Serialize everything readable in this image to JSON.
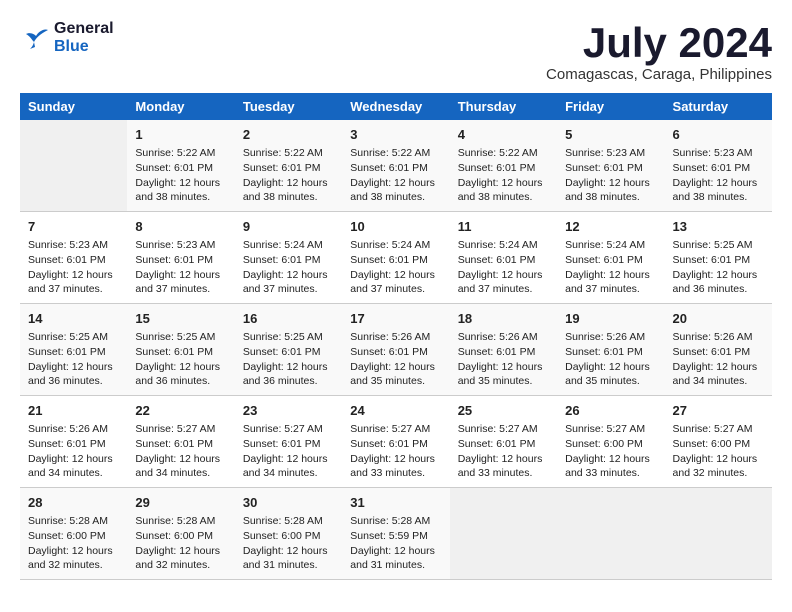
{
  "header": {
    "logo_line1": "General",
    "logo_line2": "Blue",
    "title": "July 2024",
    "subtitle": "Comagascas, Caraga, Philippines"
  },
  "calendar": {
    "days_of_week": [
      "Sunday",
      "Monday",
      "Tuesday",
      "Wednesday",
      "Thursday",
      "Friday",
      "Saturday"
    ],
    "weeks": [
      [
        {
          "day": "",
          "empty": true
        },
        {
          "day": "1",
          "sunrise": "5:22 AM",
          "sunset": "6:01 PM",
          "daylight": "12 hours and 38 minutes."
        },
        {
          "day": "2",
          "sunrise": "5:22 AM",
          "sunset": "6:01 PM",
          "daylight": "12 hours and 38 minutes."
        },
        {
          "day": "3",
          "sunrise": "5:22 AM",
          "sunset": "6:01 PM",
          "daylight": "12 hours and 38 minutes."
        },
        {
          "day": "4",
          "sunrise": "5:22 AM",
          "sunset": "6:01 PM",
          "daylight": "12 hours and 38 minutes."
        },
        {
          "day": "5",
          "sunrise": "5:23 AM",
          "sunset": "6:01 PM",
          "daylight": "12 hours and 38 minutes."
        },
        {
          "day": "6",
          "sunrise": "5:23 AM",
          "sunset": "6:01 PM",
          "daylight": "12 hours and 38 minutes."
        }
      ],
      [
        {
          "day": "7",
          "sunrise": "5:23 AM",
          "sunset": "6:01 PM",
          "daylight": "12 hours and 37 minutes."
        },
        {
          "day": "8",
          "sunrise": "5:23 AM",
          "sunset": "6:01 PM",
          "daylight": "12 hours and 37 minutes."
        },
        {
          "day": "9",
          "sunrise": "5:24 AM",
          "sunset": "6:01 PM",
          "daylight": "12 hours and 37 minutes."
        },
        {
          "day": "10",
          "sunrise": "5:24 AM",
          "sunset": "6:01 PM",
          "daylight": "12 hours and 37 minutes."
        },
        {
          "day": "11",
          "sunrise": "5:24 AM",
          "sunset": "6:01 PM",
          "daylight": "12 hours and 37 minutes."
        },
        {
          "day": "12",
          "sunrise": "5:24 AM",
          "sunset": "6:01 PM",
          "daylight": "12 hours and 37 minutes."
        },
        {
          "day": "13",
          "sunrise": "5:25 AM",
          "sunset": "6:01 PM",
          "daylight": "12 hours and 36 minutes."
        }
      ],
      [
        {
          "day": "14",
          "sunrise": "5:25 AM",
          "sunset": "6:01 PM",
          "daylight": "12 hours and 36 minutes."
        },
        {
          "day": "15",
          "sunrise": "5:25 AM",
          "sunset": "6:01 PM",
          "daylight": "12 hours and 36 minutes."
        },
        {
          "day": "16",
          "sunrise": "5:25 AM",
          "sunset": "6:01 PM",
          "daylight": "12 hours and 36 minutes."
        },
        {
          "day": "17",
          "sunrise": "5:26 AM",
          "sunset": "6:01 PM",
          "daylight": "12 hours and 35 minutes."
        },
        {
          "day": "18",
          "sunrise": "5:26 AM",
          "sunset": "6:01 PM",
          "daylight": "12 hours and 35 minutes."
        },
        {
          "day": "19",
          "sunrise": "5:26 AM",
          "sunset": "6:01 PM",
          "daylight": "12 hours and 35 minutes."
        },
        {
          "day": "20",
          "sunrise": "5:26 AM",
          "sunset": "6:01 PM",
          "daylight": "12 hours and 34 minutes."
        }
      ],
      [
        {
          "day": "21",
          "sunrise": "5:26 AM",
          "sunset": "6:01 PM",
          "daylight": "12 hours and 34 minutes."
        },
        {
          "day": "22",
          "sunrise": "5:27 AM",
          "sunset": "6:01 PM",
          "daylight": "12 hours and 34 minutes."
        },
        {
          "day": "23",
          "sunrise": "5:27 AM",
          "sunset": "6:01 PM",
          "daylight": "12 hours and 34 minutes."
        },
        {
          "day": "24",
          "sunrise": "5:27 AM",
          "sunset": "6:01 PM",
          "daylight": "12 hours and 33 minutes."
        },
        {
          "day": "25",
          "sunrise": "5:27 AM",
          "sunset": "6:01 PM",
          "daylight": "12 hours and 33 minutes."
        },
        {
          "day": "26",
          "sunrise": "5:27 AM",
          "sunset": "6:00 PM",
          "daylight": "12 hours and 33 minutes."
        },
        {
          "day": "27",
          "sunrise": "5:27 AM",
          "sunset": "6:00 PM",
          "daylight": "12 hours and 32 minutes."
        }
      ],
      [
        {
          "day": "28",
          "sunrise": "5:28 AM",
          "sunset": "6:00 PM",
          "daylight": "12 hours and 32 minutes."
        },
        {
          "day": "29",
          "sunrise": "5:28 AM",
          "sunset": "6:00 PM",
          "daylight": "12 hours and 32 minutes."
        },
        {
          "day": "30",
          "sunrise": "5:28 AM",
          "sunset": "6:00 PM",
          "daylight": "12 hours and 31 minutes."
        },
        {
          "day": "31",
          "sunrise": "5:28 AM",
          "sunset": "5:59 PM",
          "daylight": "12 hours and 31 minutes."
        },
        {
          "day": "",
          "empty": true
        },
        {
          "day": "",
          "empty": true
        },
        {
          "day": "",
          "empty": true
        }
      ]
    ]
  },
  "labels": {
    "sunrise_prefix": "Sunrise: ",
    "sunset_prefix": "Sunset: ",
    "daylight_prefix": "Daylight: "
  }
}
